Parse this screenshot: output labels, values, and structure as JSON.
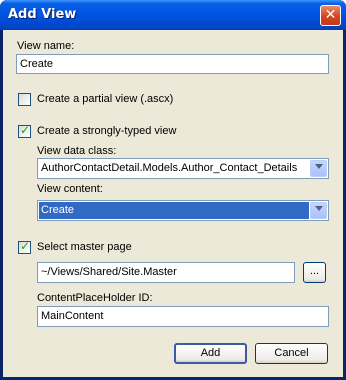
{
  "window": {
    "title": "Add View",
    "close_glyph": "✕"
  },
  "view_name": {
    "label": "View name:",
    "value": "Create"
  },
  "partial_view": {
    "label": "Create a partial view (.ascx)",
    "checked": false
  },
  "strongly_typed": {
    "label": "Create a strongly-typed view",
    "checked": true
  },
  "view_data_class": {
    "label": "View data class:",
    "value": "AuthorContactDetail.Models.Author_Contact_Details"
  },
  "view_content": {
    "label": "View content:",
    "value": "Create"
  },
  "master_page": {
    "label": "Select master page",
    "checked": true,
    "path": "~/Views/Shared/Site.Master",
    "browse_label": "..."
  },
  "content_placeholder": {
    "label": "ContentPlaceHolder ID:",
    "value": "MainContent"
  },
  "buttons": {
    "add": "Add",
    "cancel": "Cancel"
  },
  "icons": {
    "checkbox_checked": "checkmark-icon",
    "dropdown": "chevron-down-icon",
    "close": "close-icon"
  }
}
